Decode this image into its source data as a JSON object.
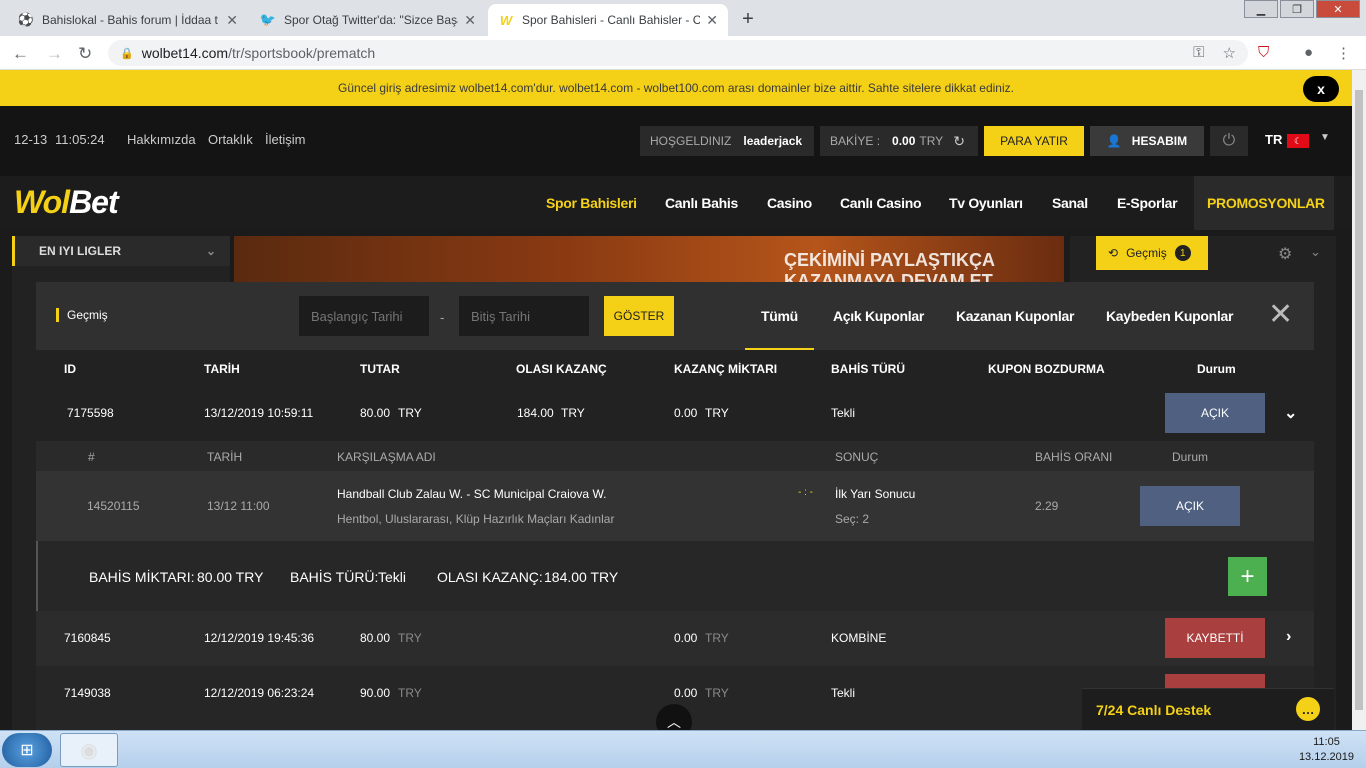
{
  "browser": {
    "tabs": [
      {
        "title": "Bahislokal - Bahis forum | İddaa t",
        "icon": "soccer-ball-icon"
      },
      {
        "title": "Spor Otağ Twitter'da: \"Sizce Başa",
        "icon": "twitter-bird-icon"
      },
      {
        "title": "Spor Bahisleri - Canlı Bahisler - C",
        "icon": "wolbet-w-icon"
      }
    ],
    "url_host": "wolbet14.com",
    "url_path": "/tr/sportsbook/prematch"
  },
  "banner": {
    "text": "Güncel giriş adresimiz wolbet14.com'dur. wolbet14.com - wolbet100.com arası domainler bize aittir. Sahte sitelere dikkat ediniz.",
    "close": "x"
  },
  "topbar": {
    "date": "12-13",
    "time": "11:05:24",
    "links": [
      "Hakkımızda",
      "Ortaklık",
      "İletişim"
    ],
    "welcome_label": "HOŞGELDINIZ",
    "username": "leaderjack",
    "balance_label": "BAKİYE :",
    "balance_value": "0.00",
    "balance_currency": "TRY",
    "deposit": "PARA YATIR",
    "account": "HESABIM",
    "lang": "TR"
  },
  "nav": {
    "logo_w": "Wol",
    "logo_rest": "Bet",
    "items": [
      "Spor Bahisleri",
      "Canlı Bahis",
      "Casino",
      "Canlı Casino",
      "Tv Oyunları",
      "Sanal",
      "E-Sporlar",
      "PROMOSYONLAR"
    ]
  },
  "background": {
    "left_title": "EN IYI LIGLER",
    "promo_text": "ÇEKİMİNİ PAYLAŞTIKÇA KAZANMAYA DEVAM ET",
    "right_history": "Geçmiş",
    "right_count": "1"
  },
  "modal": {
    "title": "Geçmiş",
    "start_placeholder": "Başlangıç Tarihi",
    "end_placeholder": "Bitiş Tarihi",
    "dash": "-",
    "show": "GÖSTER",
    "filters": [
      "Tümü",
      "Açık Kuponlar",
      "Kazanan Kuponlar",
      "Kaybeden Kuponlar"
    ],
    "close": "✕",
    "columns": [
      "ID",
      "TARİH",
      "TUTAR",
      "OLASI KAZANÇ",
      "KAZANÇ MİKTARI",
      "BAHİS TÜRÜ",
      "KUPON BOZDURMA",
      "Durum"
    ],
    "rows": [
      {
        "id": "7175598",
        "date": "13/12/2019 10:59:11",
        "amount": "80.00",
        "cur": "TRY",
        "possible": "184.00",
        "possible_cur": "TRY",
        "win": "0.00",
        "win_cur": "TRY",
        "type": "Tekli",
        "status": "AÇIK"
      },
      {
        "id": "7160845",
        "date": "12/12/2019 19:45:36",
        "amount": "80.00",
        "cur": "TRY",
        "possible": "",
        "possible_cur": "",
        "win": "0.00",
        "win_cur": "TRY",
        "type": "KOMBİNE",
        "status": "KAYBETTİ"
      },
      {
        "id": "7149038",
        "date": "12/12/2019 06:23:24",
        "amount": "90.00",
        "cur": "TRY",
        "possible": "",
        "possible_cur": "",
        "win": "0.00",
        "win_cur": "TRY",
        "type": "Tekli",
        "status": ""
      }
    ],
    "detail_columns": [
      "#",
      "TARİH",
      "KARŞILAŞMA ADI",
      "SONUÇ",
      "BAHİS ORANI",
      "Durum"
    ],
    "detail": {
      "id": "14520115",
      "date": "13/12 11:00",
      "match": "Handball Club Zalau W. - SC Municipal Craiova W.",
      "league": "Hentbol, Uluslararası, Klüp Hazırlık Maçları Kadınlar",
      "score": "- : -",
      "result": "İlk Yarı Sonucu",
      "pick": "Seç:  2",
      "odds": "2.29",
      "status": "AÇIK"
    },
    "summary": {
      "stake_label": "BAHİS MİKTARI:",
      "stake": "80.00 TRY",
      "type_label": "BAHİS TÜRÜ:",
      "type": "Tekli",
      "possible_label": "OLASI KAZANÇ:",
      "possible": "184.00 TRY",
      "plus": "+"
    }
  },
  "support": {
    "label": "7/24 Canlı Destek"
  },
  "taskbar": {
    "time": "11:05",
    "date": "13.12.2019"
  },
  "colors": {
    "accent": "#f4d117",
    "open": "#4f6080",
    "lost": "#a9403f",
    "add": "#4caf50"
  }
}
